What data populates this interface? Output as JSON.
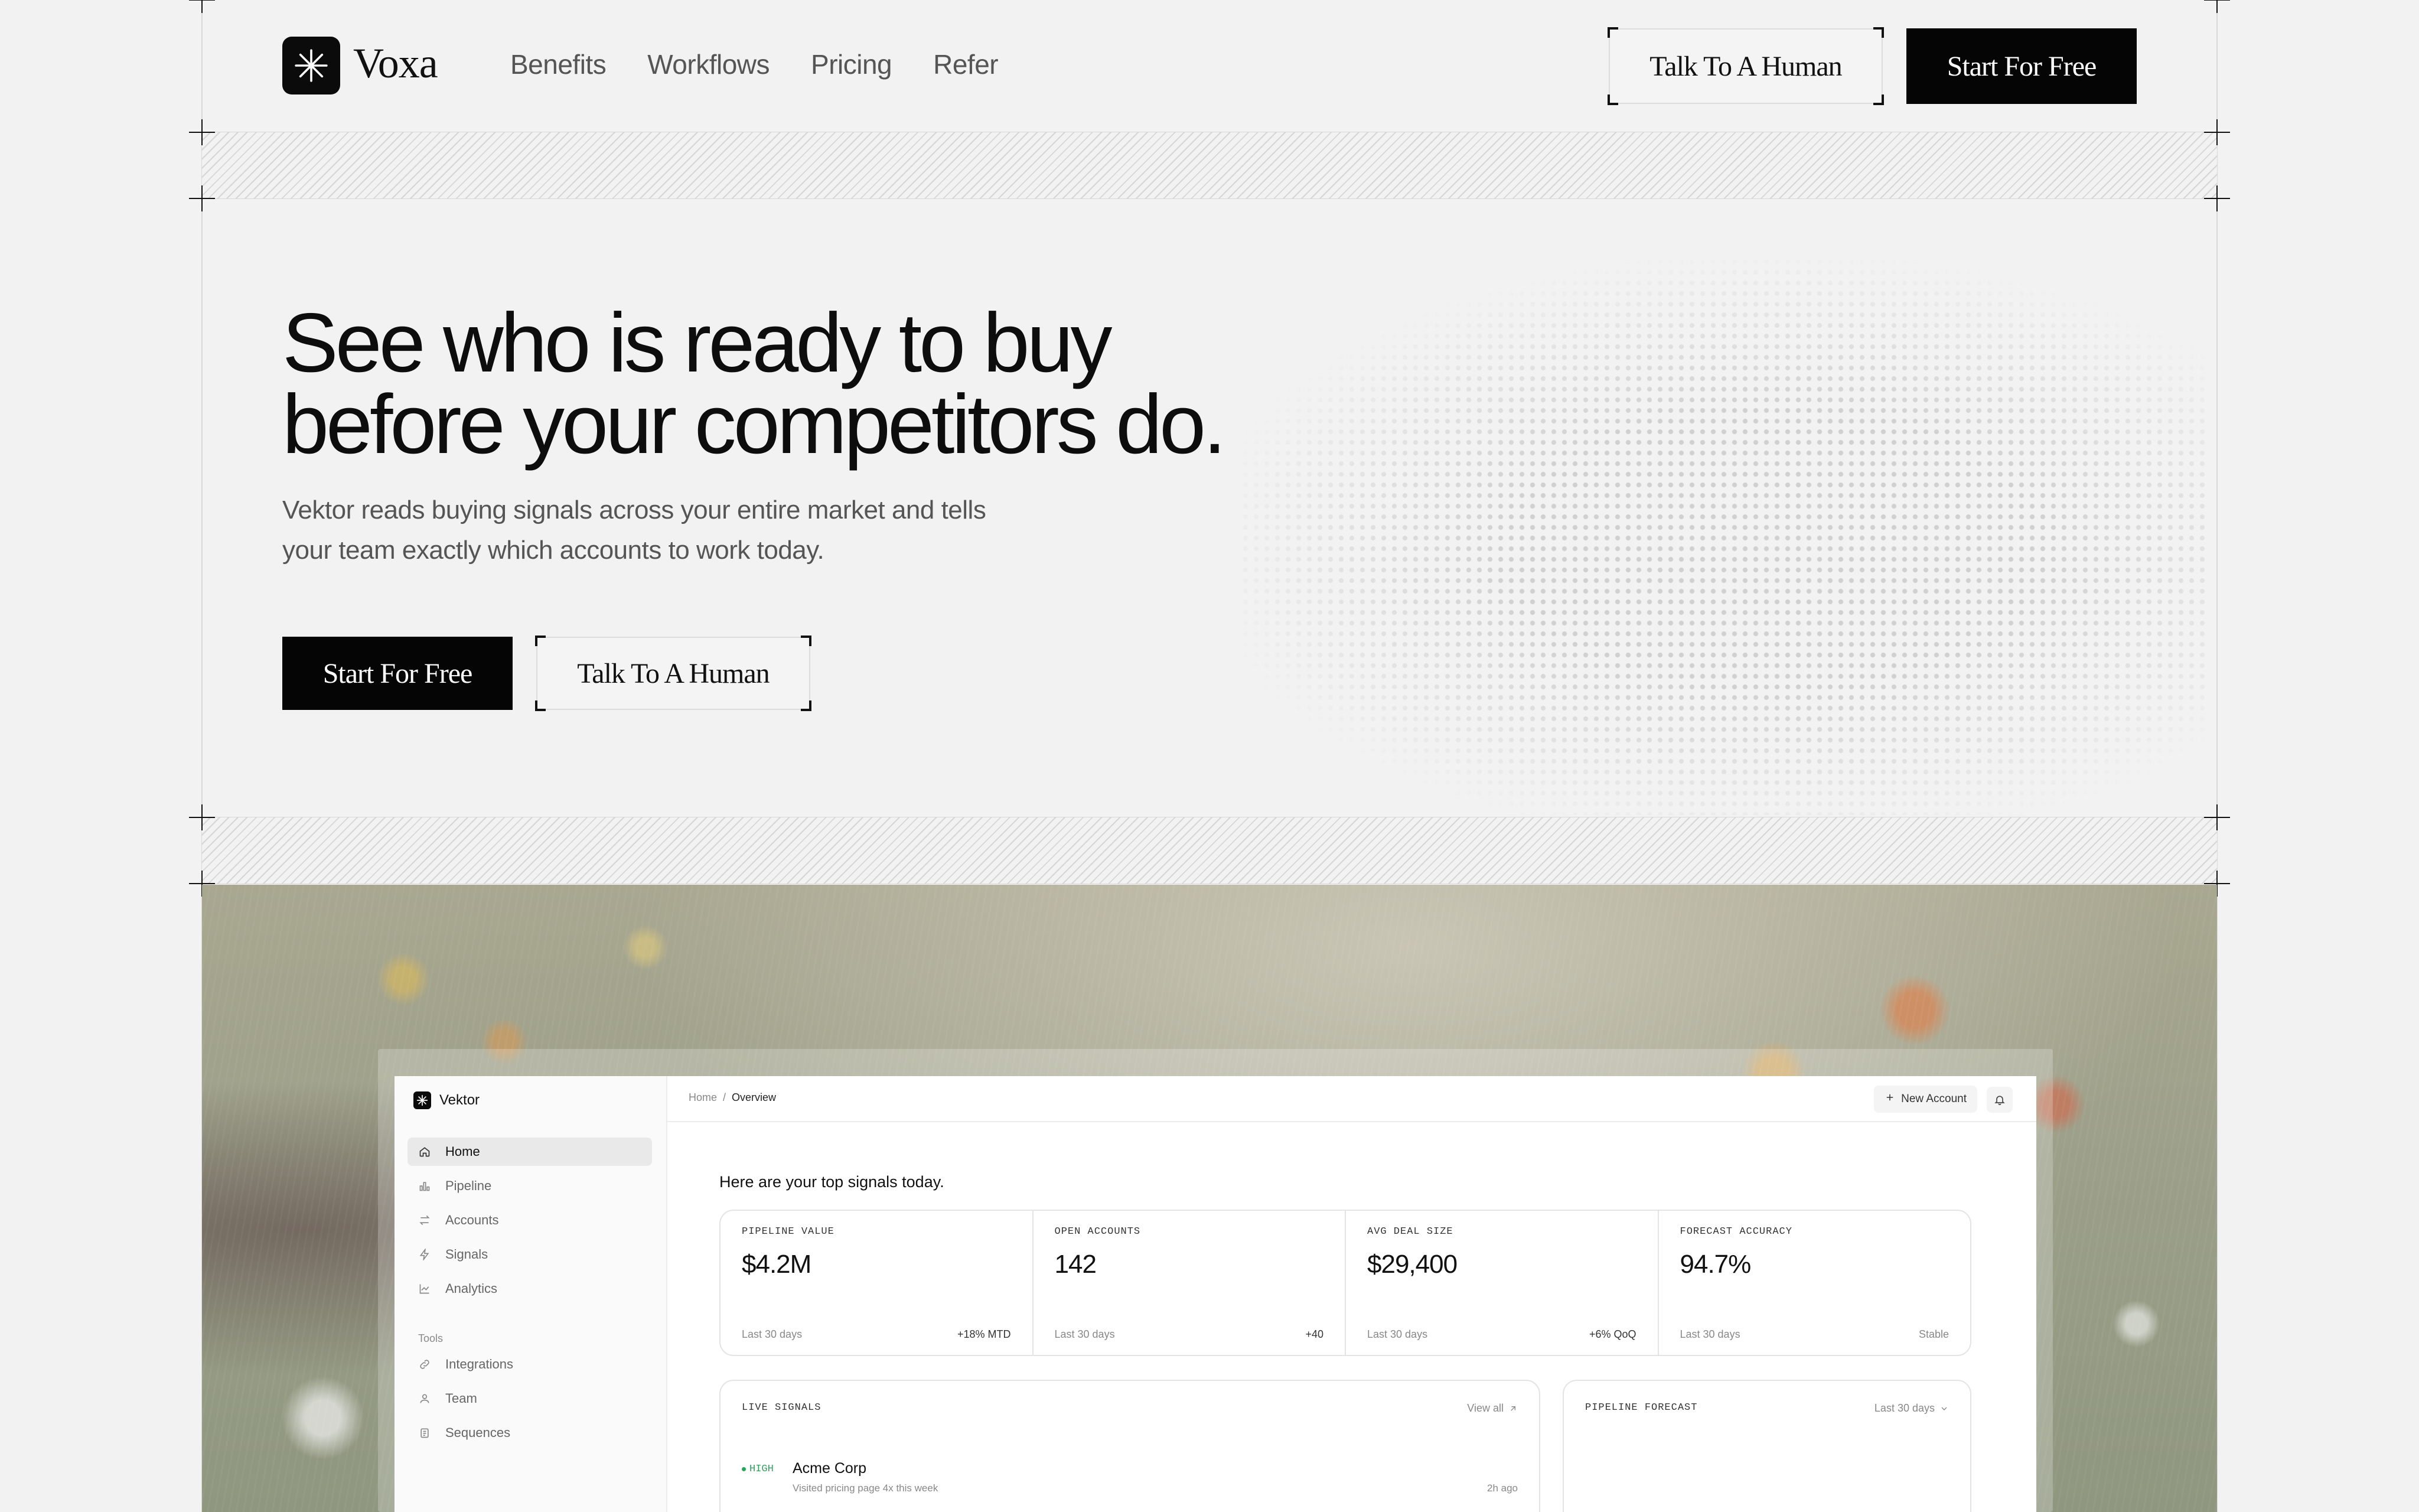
{
  "nav": {
    "brand": "Voxa",
    "links": [
      "Benefits",
      "Workflows",
      "Pricing",
      "Refer"
    ],
    "talk_label": "Talk To A Human",
    "start_label": "Start For Free"
  },
  "hero": {
    "title_line1": "See who is ready to buy",
    "title_line2": "before your competitors do.",
    "subtitle_line1": "Vektor reads buying signals across your entire market and tells",
    "subtitle_line2": "your team exactly which accounts to work today.",
    "start_label": "Start For Free",
    "talk_label": "Talk To A Human"
  },
  "dashboard": {
    "brand": "Vektor",
    "nav_items": [
      "Home",
      "Pipeline",
      "Accounts",
      "Signals",
      "Analytics"
    ],
    "tools_label": "Tools",
    "tool_items": [
      "Integrations",
      "Team",
      "Sequences"
    ],
    "breadcrumb": {
      "home": "Home",
      "sep": "/",
      "current": "Overview"
    },
    "new_account_label": "New Account",
    "greeting": "Here are your top signals today.",
    "stats": [
      {
        "label": "PIPELINE VALUE",
        "value": "$4.2M",
        "period": "Last 30 days",
        "change": "+18% MTD"
      },
      {
        "label": "OPEN ACCOUNTS",
        "value": "142",
        "period": "Last 30 days",
        "change": "+40"
      },
      {
        "label": "AVG DEAL SIZE",
        "value": "$29,400",
        "period": "Last 30 days",
        "change": "+6% QoQ"
      },
      {
        "label": "FORECAST ACCURACY",
        "value": "94.7%",
        "period": "Last 30 days",
        "change": "Stable"
      }
    ],
    "live_signals": {
      "title": "LIVE SIGNALS",
      "link": "View all",
      "rows": [
        {
          "badge": "HIGH",
          "name": "Acme Corp",
          "note": "Visited pricing page 4x this week",
          "time": "2h ago"
        }
      ]
    },
    "pipeline_forecast": {
      "title": "PIPELINE FORECAST",
      "range": "Last 30 days"
    }
  }
}
